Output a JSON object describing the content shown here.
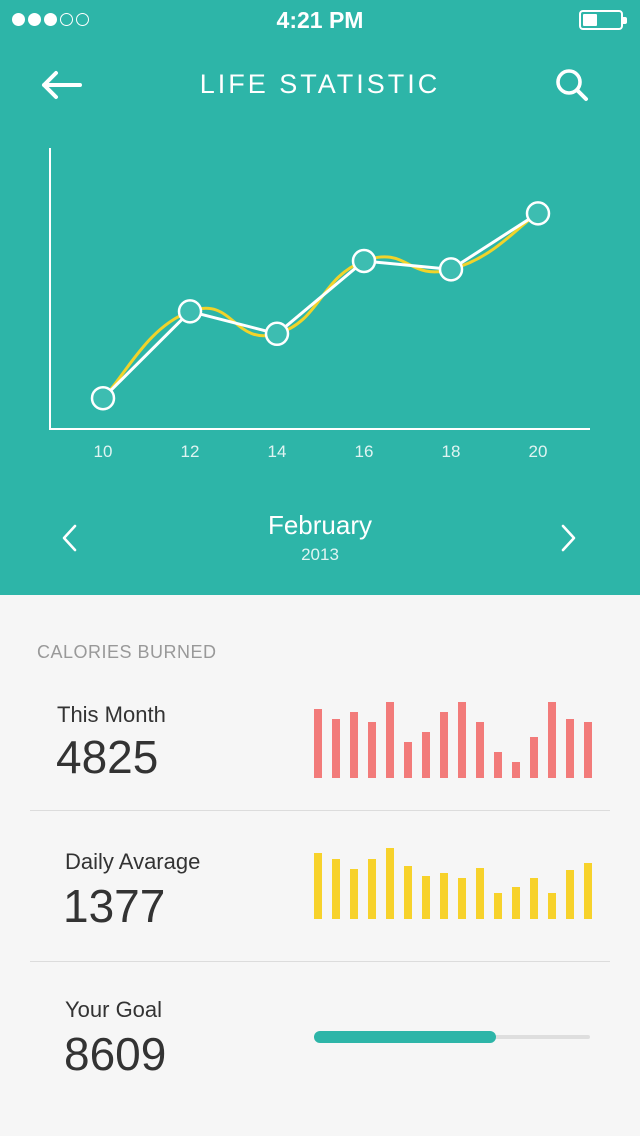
{
  "status_bar": {
    "signal_dots_filled": 3,
    "signal_dots_total": 5,
    "time": "4:21 PM",
    "battery_level": 0.4
  },
  "header": {
    "title": "LIFE STATISTIC",
    "back_icon": "arrow-left-icon",
    "search_icon": "search-icon"
  },
  "chart_data": {
    "type": "line",
    "x": [
      10,
      12,
      14,
      16,
      18,
      20
    ],
    "values": [
      1.1,
      4.2,
      3.4,
      6.0,
      5.7,
      7.7
    ],
    "ylim": [
      0,
      10
    ],
    "xlabel": "",
    "ylabel": "",
    "tick_labels": [
      "10",
      "12",
      "14",
      "16",
      "18",
      "20"
    ],
    "colors": {
      "line": "#ffffff",
      "smooth_line": "#f1d32a",
      "point_fill": "#3dbdb1"
    },
    "grid": false
  },
  "month_nav": {
    "month": "February",
    "year": "2013",
    "prev_icon": "chevron-left-icon",
    "next_icon": "chevron-right-icon"
  },
  "calories": {
    "section_label": "CALORIES BURNED",
    "this_month": {
      "label": "This Month",
      "value": "4825",
      "bar_color": "#f27b7a",
      "bars": [
        69,
        59,
        66,
        56,
        76,
        36,
        46,
        66,
        76,
        56,
        26,
        16,
        41,
        76,
        59,
        56
      ]
    },
    "daily_average": {
      "label": "Daily Avarage",
      "value": "1377",
      "bar_color": "#f7d22b",
      "bars": [
        66,
        60,
        50,
        60,
        71,
        53,
        43,
        46,
        41,
        51,
        26,
        32,
        41,
        26,
        49,
        56
      ]
    },
    "your_goal": {
      "label": "Your Goal",
      "value": "8609",
      "progress": 0.66,
      "progress_color": "#2db5a8"
    }
  }
}
